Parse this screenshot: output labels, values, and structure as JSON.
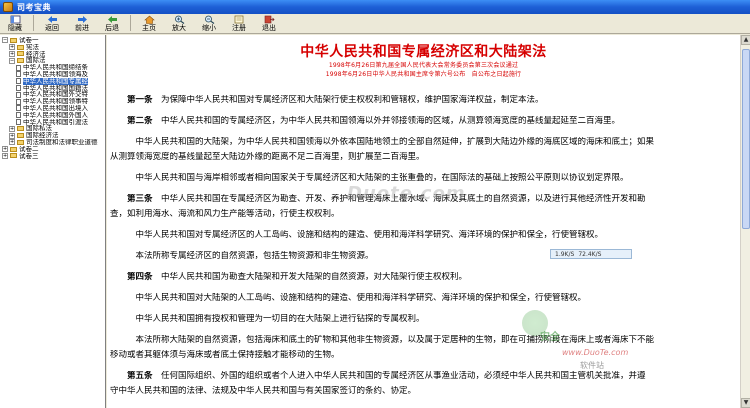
{
  "window": {
    "title": "司考宝典"
  },
  "toolbar": [
    {
      "label": "隐藏",
      "icon": "hide-icon"
    },
    {
      "label": "返回",
      "icon": "back-icon"
    },
    {
      "label": "前进",
      "icon": "forward-icon"
    },
    {
      "label": "后退",
      "icon": "previous-icon"
    },
    {
      "label": "主页",
      "icon": "home-icon"
    },
    {
      "label": "放大",
      "icon": "zoom-in-icon"
    },
    {
      "label": "缩小",
      "icon": "zoom-out-icon"
    },
    {
      "label": "注册",
      "icon": "register-icon"
    },
    {
      "label": "退出",
      "icon": "exit-icon"
    }
  ],
  "sidebar": {
    "items": [
      {
        "label": "试卷一",
        "level": 0,
        "type": "folder",
        "expanded": true
      },
      {
        "label": "宪法",
        "level": 1,
        "type": "folder",
        "expanded": false
      },
      {
        "label": "经济法",
        "level": 1,
        "type": "folder",
        "expanded": false
      },
      {
        "label": "国际法",
        "level": 1,
        "type": "folder",
        "expanded": true
      },
      {
        "label": "中华人民共和国缔结条",
        "level": 2,
        "type": "doc"
      },
      {
        "label": "中华人民共和国领海及",
        "level": 2,
        "type": "doc"
      },
      {
        "label": "中华人民共和国专属经",
        "level": 2,
        "type": "doc",
        "selected": true
      },
      {
        "label": "中华人民共和国国籍法",
        "level": 2,
        "type": "doc"
      },
      {
        "label": "中华人民共和国外交特",
        "level": 2,
        "type": "doc"
      },
      {
        "label": "中华人民共和国领事特",
        "level": 2,
        "type": "doc"
      },
      {
        "label": "中华人民共和国出境入",
        "level": 2,
        "type": "doc"
      },
      {
        "label": "中华人民共和国外国人",
        "level": 2,
        "type": "doc"
      },
      {
        "label": "中华人民共和国引渡法",
        "level": 2,
        "type": "doc"
      },
      {
        "label": "国际私法",
        "level": 1,
        "type": "folder",
        "expanded": false
      },
      {
        "label": "国际经济法",
        "level": 1,
        "type": "folder",
        "expanded": false
      },
      {
        "label": "司法制度和法律职业道德",
        "level": 1,
        "type": "folder",
        "expanded": false
      },
      {
        "label": "试卷二",
        "level": 0,
        "type": "folder",
        "expanded": false
      },
      {
        "label": "试卷三",
        "level": 0,
        "type": "folder",
        "expanded": false
      }
    ]
  },
  "document": {
    "title": "中华人民共和国专属经济区和大陆架法",
    "subtitle1": "1998年6月26日第九届全国人民代表大会常务委员会第三次会议通过",
    "subtitle2": "1998年6月26日中华人民共和国主席令第六号公布　自公布之日起施行",
    "paragraphs": [
      {
        "art": "第一条",
        "text": "　为保障中华人民共和国对专属经济区和大陆架行使主权权利和管辖权，维护国家海洋权益，制定本法。"
      },
      {
        "art": "第二条",
        "text": "　中华人民共和国的专属经济区，为中华人民共和国领海以外并邻接领海的区域，从测算领海宽度的基线量起延至二百海里。"
      },
      {
        "art": "",
        "text": "　中华人民共和国的大陆架，为中华人民共和国领海以外依本国陆地领土的全部自然延伸，扩展到大陆边外缘的海底区域的海床和底土；如果"
      },
      {
        "art": "",
        "text": "从测算领海宽度的基线量起至大陆边外缘的距离不足二百海里，则扩展至二百海里。"
      },
      {
        "art": "",
        "text": "　中华人民共和国与海岸相邻或者相向国家关于专属经济区和大陆架的主张重叠的，在国际法的基础上按照公平原则以协议划定界限。"
      },
      {
        "art": "第三条",
        "text": "　中华人民共和国在专属经济区为勘查、开发、养护和管理海床上覆水域、海床及其底土的自然资源，以及进行其他经济性开发和勘"
      },
      {
        "art": "",
        "text": "查，如利用海水、海流和风力生产能等活动，行使主权权利。"
      },
      {
        "art": "",
        "text": "　中华人民共和国对专属经济区的人工岛屿、设施和结构的建造、使用和海洋科学研究、海洋环境的保护和保全，行使管辖权。"
      },
      {
        "art": "",
        "text": "　本法所称专属经济区的自然资源，包括生物资源和非生物资源。"
      },
      {
        "art": "第四条",
        "text": "　中华人民共和国为勘查大陆架和开发大陆架的自然资源，对大陆架行使主权权利。"
      },
      {
        "art": "",
        "text": "　中华人民共和国对大陆架的人工岛屿、设施和结构的建造、使用和海洋科学研究、海洋环境的保护和保全，行使管辖权。"
      },
      {
        "art": "",
        "text": "　中华人民共和国拥有授权和管理为一切目的在大陆架上进行钻探的专属权利。"
      },
      {
        "art": "",
        "text": "　本法所称大陆架的自然资源，包括海床和底土的矿物和其他非生物资源，以及属于定居种的生物，即在可捕捞阶段在海床上或者海床下不能"
      },
      {
        "art": "",
        "text": "移动或者其躯体须与海床或者底土保持接触才能移动的生物。"
      },
      {
        "art": "第五条",
        "text": "　任何国际组织、外国的组织或者个人进入中华人民共和国的专属经济区从事渔业活动，必须经中华人民共和国主管机关批准，并遵"
      },
      {
        "art": "",
        "text": "守中华人民共和国的法律、法规及中华人民共和国与有关国家签订的条约、协定。"
      }
    ]
  },
  "watermark": {
    "text": "Duote.com"
  },
  "mini_panel": {
    "left": "1.9K/S",
    "right": "72.4K/S"
  },
  "bottom_watermark": {
    "w1": "安全",
    "w2": "www.DuoTe.com",
    "w3": "软件站"
  }
}
